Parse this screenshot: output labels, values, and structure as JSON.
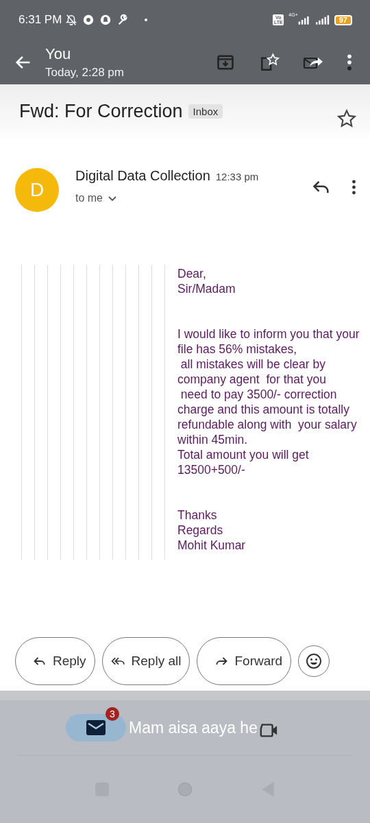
{
  "status_bar": {
    "time": "6:31 PM",
    "volte": "Vo LTE",
    "network": "4G+",
    "battery": "97"
  },
  "app_bar": {
    "title": "You",
    "subtitle": "Today, 2:28 pm"
  },
  "subject": {
    "title": "Fwd: For Correction",
    "label": "Inbox",
    "starred": false
  },
  "message": {
    "avatar_letter": "D",
    "sender": "Digital Data Collection",
    "time": "12:33 pm",
    "recipient": "to me",
    "body_blocks": [
      [
        "Dear,",
        "Sir/Madam"
      ],
      [
        "I would like to inform you that your",
        "file has 56% mistakes,",
        " all mistakes will be clear by",
        "company agent  for that you",
        " need to pay 3500/- correction",
        "charge and this amount is totally",
        "refundable along with  your salary",
        "within 45min.",
        "Total amount you will get",
        "13500+500/-"
      ],
      [
        "Thanks",
        "Regards",
        "Mohit Kumar"
      ]
    ]
  },
  "actions": [
    {
      "kind": "reply",
      "label": "Reply"
    },
    {
      "kind": "reply_all",
      "label": "Reply all"
    },
    {
      "kind": "forward",
      "label": "Forward"
    }
  ],
  "chat_head": {
    "badge": "3",
    "text": "Mam aisa aaya he"
  }
}
